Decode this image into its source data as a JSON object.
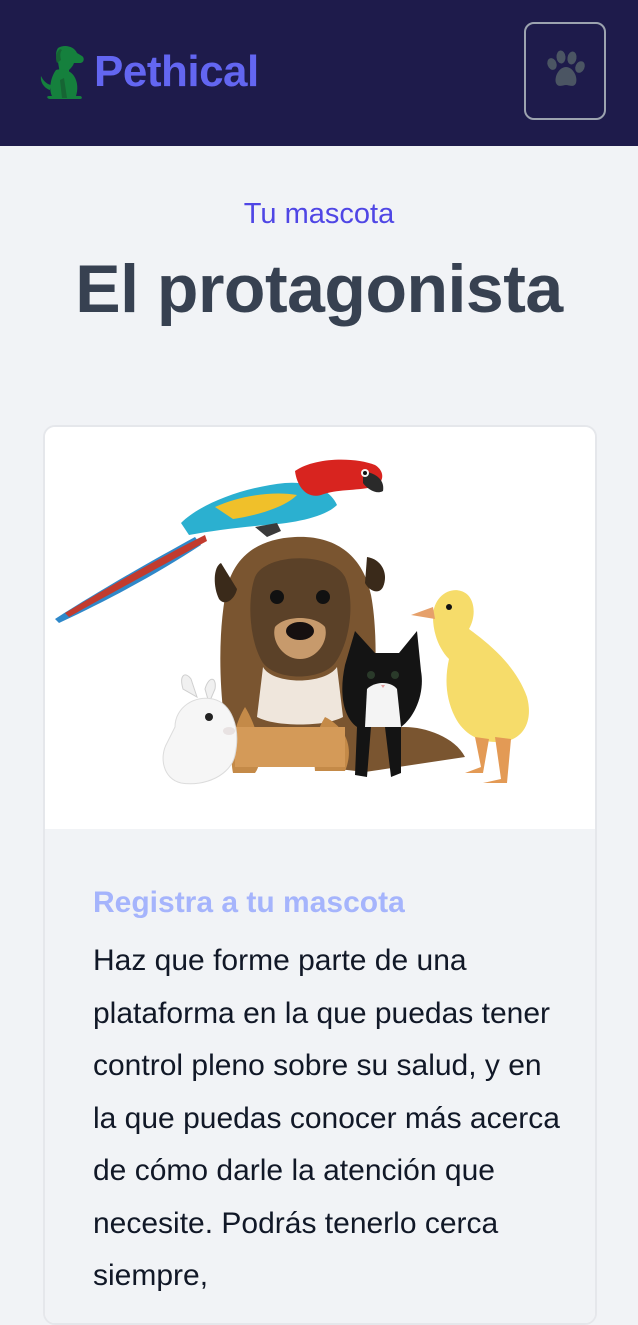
{
  "brand": {
    "name": "Pethical",
    "logo_icon": "dog-icon",
    "logo_color": "#15803d",
    "name_color": "#6366f1"
  },
  "nav": {
    "menu_icon": "paw-icon",
    "background": "#1e1b4b"
  },
  "hero": {
    "eyebrow": "Tu mascota",
    "title": "El protagonista"
  },
  "feature_card": {
    "image_icon": "pets-group-image",
    "subtitle": "Registra a tu mascota",
    "text": "Haz que forme parte de una plataforma en la que puedas tener control pleno sobre su salud, y en la que puedas conocer más acerca de cómo darle la atención que necesite. Podrás tenerlo cerca siempre,"
  }
}
